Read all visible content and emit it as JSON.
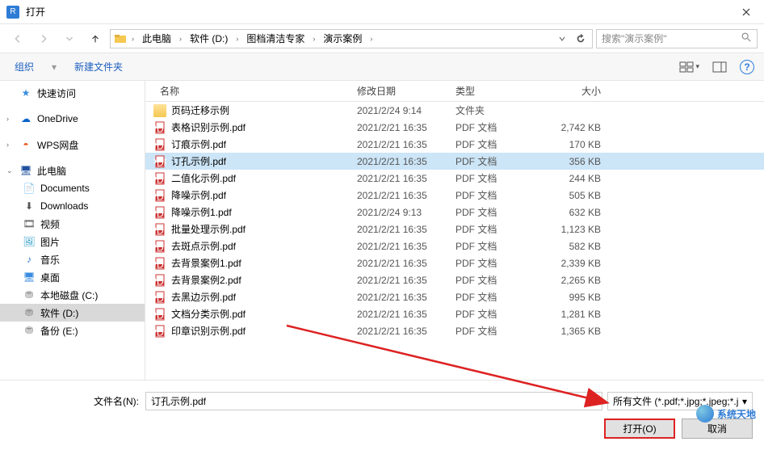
{
  "window": {
    "title": "打开"
  },
  "breadcrumb": {
    "root": "此电脑",
    "drive": "软件 (D:)",
    "folder1": "图档清洁专家",
    "folder2": "演示案例"
  },
  "search": {
    "placeholder": "搜索\"演示案例\""
  },
  "toolbar": {
    "organize": "组织",
    "newfolder": "新建文件夹"
  },
  "columns": {
    "name": "名称",
    "date": "修改日期",
    "type": "类型",
    "size": "大小"
  },
  "sidebar": {
    "quick": "快速访问",
    "onedrive": "OneDrive",
    "wps": "WPS网盘",
    "thispc": "此电脑",
    "docs": "Documents",
    "downloads": "Downloads",
    "videos": "视频",
    "pictures": "图片",
    "music": "音乐",
    "desktop": "桌面",
    "diskc": "本地磁盘 (C:)",
    "diskd": "软件 (D:)",
    "diske": "备份 (E:)"
  },
  "files": [
    {
      "name": "页码迁移示例",
      "date": "2021/2/24 9:14",
      "type": "文件夹",
      "size": "",
      "kind": "folder"
    },
    {
      "name": "表格识别示例.pdf",
      "date": "2021/2/21 16:35",
      "type": "PDF 文档",
      "size": "2,742 KB",
      "kind": "pdf"
    },
    {
      "name": "订痕示例.pdf",
      "date": "2021/2/21 16:35",
      "type": "PDF 文档",
      "size": "170 KB",
      "kind": "pdf"
    },
    {
      "name": "订孔示例.pdf",
      "date": "2021/2/21 16:35",
      "type": "PDF 文档",
      "size": "356 KB",
      "kind": "pdf",
      "selected": true
    },
    {
      "name": "二值化示例.pdf",
      "date": "2021/2/21 16:35",
      "type": "PDF 文档",
      "size": "244 KB",
      "kind": "pdf"
    },
    {
      "name": "降噪示例.pdf",
      "date": "2021/2/21 16:35",
      "type": "PDF 文档",
      "size": "505 KB",
      "kind": "pdf"
    },
    {
      "name": "降噪示例1.pdf",
      "date": "2021/2/24 9:13",
      "type": "PDF 文档",
      "size": "632 KB",
      "kind": "pdf"
    },
    {
      "name": "批量处理示例.pdf",
      "date": "2021/2/21 16:35",
      "type": "PDF 文档",
      "size": "1,123 KB",
      "kind": "pdf"
    },
    {
      "name": "去斑点示例.pdf",
      "date": "2021/2/21 16:35",
      "type": "PDF 文档",
      "size": "582 KB",
      "kind": "pdf"
    },
    {
      "name": "去背景案例1.pdf",
      "date": "2021/2/21 16:35",
      "type": "PDF 文档",
      "size": "2,339 KB",
      "kind": "pdf"
    },
    {
      "name": "去背景案例2.pdf",
      "date": "2021/2/21 16:35",
      "type": "PDF 文档",
      "size": "2,265 KB",
      "kind": "pdf"
    },
    {
      "name": "去黑边示例.pdf",
      "date": "2021/2/21 16:35",
      "type": "PDF 文档",
      "size": "995 KB",
      "kind": "pdf"
    },
    {
      "name": "文档分类示例.pdf",
      "date": "2021/2/21 16:35",
      "type": "PDF 文档",
      "size": "1,281 KB",
      "kind": "pdf"
    },
    {
      "name": "印章识别示例.pdf",
      "date": "2021/2/21 16:35",
      "type": "PDF 文档",
      "size": "1,365 KB",
      "kind": "pdf"
    }
  ],
  "footer": {
    "filename_label": "文件名(N):",
    "filename_value": "订孔示例.pdf",
    "filetype": "所有文件 (*.pdf;*.jpg;*.jpeg;*.j",
    "open": "打开(O)",
    "cancel": "取消"
  },
  "watermark": "系统天地"
}
